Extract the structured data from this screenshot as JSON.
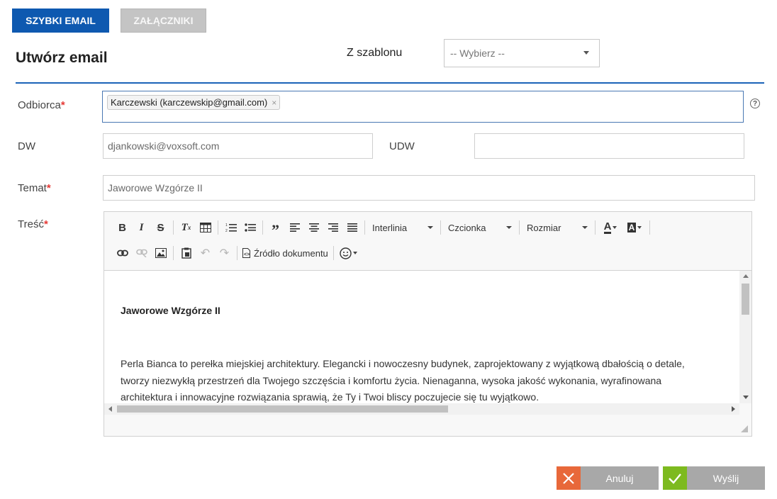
{
  "tabs": {
    "quick_email": "SZYBKI EMAIL",
    "attachments": "ZAŁĄCZNIKI"
  },
  "page_title": "Utwórz email",
  "template": {
    "label": "Z szablonu",
    "selected": "-- Wybierz --"
  },
  "fields": {
    "recipient": {
      "label": "Odbiorca",
      "required_mark": "*",
      "chip": "Karczewski (karczewskip@gmail.com)",
      "chip_remove": "×",
      "help": "?"
    },
    "cc": {
      "label": "DW",
      "value": "djankowski@voxsoft.com"
    },
    "bcc": {
      "label": "UDW",
      "value": ""
    },
    "subject": {
      "label": "Temat",
      "required_mark": "*",
      "value": "Jaworowe Wzgórze II"
    },
    "body": {
      "label": "Treść",
      "required_mark": "*"
    }
  },
  "editor": {
    "line_height": "Interlinia",
    "font": "Czcionka",
    "size": "Rozmiar",
    "source": "Źródło dokumentu",
    "content_title": "Jaworowe Wzgórze II",
    "content_body": "Perla Bianca to perełka miejskiej architektury. Elegancki i nowoczesny budynek, zaprojektowany z wyjątkową dbałością o detale, tworzy niezwykłą przestrzeń dla Twojego szczęścia i komfortu życia. Nienaganna, wysoka jakość wykonania, wyrafinowana architektura i innowacyjne rozwiązania sprawią, że Ty i Twoi bliscy poczujecie się tu wyjątkowo."
  },
  "buttons": {
    "cancel": "Anuluj",
    "send": "Wyślij"
  },
  "colors": {
    "primary": "#0e59b0",
    "cancel": "#e8683a",
    "send": "#7dba1f",
    "required": "#e53935"
  }
}
